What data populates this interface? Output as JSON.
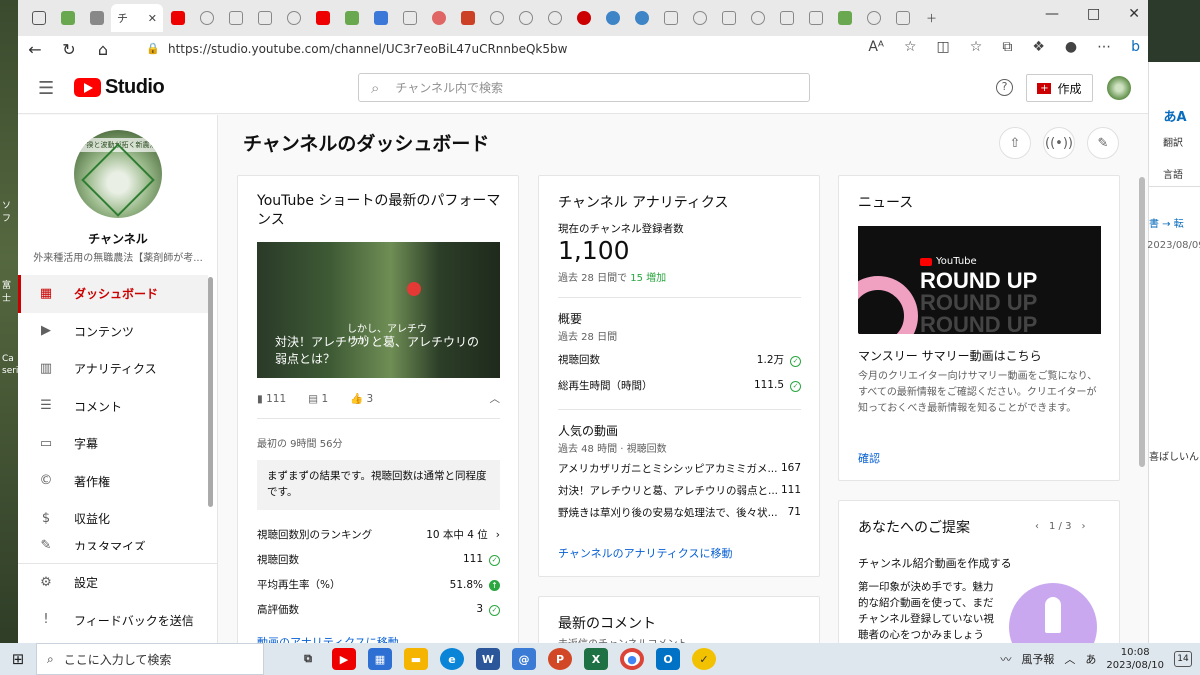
{
  "browser": {
    "url": "https://studio.youtube.com/channel/UC3r7eoBiL47uCRnnbeQk5bw",
    "active_tab_label": "チ",
    "reader_icon_text": "Aᴬ"
  },
  "studio": {
    "logo_text": "Studio",
    "search_placeholder": "チャンネル内で検索",
    "create_label": "作成",
    "help_symbol": "?"
  },
  "sidebar": {
    "channel_name": "チャンネル",
    "channel_subtitle": "外来種活用の無職農法【薬剤師が考...",
    "avatar_band_text": "一揆と波動が拓く新農法",
    "items": [
      {
        "label": "ダッシュボード",
        "icon": "dashboard-icon",
        "glyph": "▦",
        "active": true
      },
      {
        "label": "コンテンツ",
        "icon": "content-icon",
        "glyph": "▶"
      },
      {
        "label": "アナリティクス",
        "icon": "analytics-icon",
        "glyph": "▥"
      },
      {
        "label": "コメント",
        "icon": "comments-icon",
        "glyph": "☰"
      },
      {
        "label": "字幕",
        "icon": "subtitles-icon",
        "glyph": "▭"
      },
      {
        "label": "著作権",
        "icon": "copyright-icon",
        "glyph": "©"
      },
      {
        "label": "収益化",
        "icon": "earn-icon",
        "glyph": "$"
      },
      {
        "label": "カスタマイズ",
        "icon": "customize-icon",
        "glyph": "✎"
      }
    ],
    "bottom_items": [
      {
        "label": "設定",
        "icon": "settings-icon",
        "glyph": "⚙"
      },
      {
        "label": "フィードバックを送信",
        "icon": "feedback-icon",
        "glyph": "!"
      }
    ]
  },
  "dashboard": {
    "title": "チャンネルのダッシュボード",
    "shorts": {
      "title": "YouTube ショートの最新のパフォーマンス",
      "video_title": "対決！アレチウリと葛、アレチウリの弱点とは？",
      "overlay_text": "しかし、アレチウリが",
      "views": "111",
      "comments": "1",
      "likes": "3",
      "first_period": "最初の 9時間 56分",
      "message": "まずまずの結果です。視聴回数は通常と同程度です。",
      "stats": [
        {
          "label": "視聴回数別のランキング",
          "value": "10 本中 4 位",
          "indicator": "chevron"
        },
        {
          "label": "視聴回数",
          "value": "111",
          "indicator": "check"
        },
        {
          "label": "平均再生率（%）",
          "value": "51.8%",
          "indicator": "up"
        },
        {
          "label": "高評価数",
          "value": "3",
          "indicator": "check"
        }
      ],
      "link": "動画のアナリティクスに移動"
    },
    "analytics": {
      "title": "チャンネル アナリティクス",
      "subs_label": "現在のチャンネル登録者数",
      "subs_value": "1,100",
      "subs_change_prefix": "過去 28 日間で",
      "subs_change": "15 増加",
      "summary_title": "概要",
      "summary_period": "過去 28 日間",
      "summary_rows": [
        {
          "label": "視聴回数",
          "value": "1.2万"
        },
        {
          "label": "総再生時間（時間）",
          "value": "111.5"
        }
      ],
      "top_title": "人気の動画",
      "top_period": "過去 48 時間 · 視聴回数",
      "top_videos": [
        {
          "title": "アメリカザリガニとミシシッピアカミミガメ...",
          "views": "167"
        },
        {
          "title": "対決！アレチウリと葛、アレチウリの弱点と...",
          "views": "111"
        },
        {
          "title": "野焼きは草刈り後の安易な処理法で、後々状...",
          "views": "71"
        }
      ],
      "link": "チャンネルのアナリティクスに移動"
    },
    "comments": {
      "title": "最新のコメント",
      "subtitle": "未返信のチャンネルコメント"
    },
    "news": {
      "title": "ニュース",
      "image_brand": "YouTube",
      "image_text": "ROUND UP",
      "headline": "マンスリー サマリー動画はこちら",
      "body": "今月のクリエイター向けサマリー動画をご覧になり、すべての最新情報をご確認ください。クリエイターが知っておくべき最新情報を知ることができます。",
      "link": "確認"
    },
    "suggestions": {
      "title": "あなたへのご提案",
      "pager": "1 / 3",
      "headline": "チャンネル紹介動画を作成する",
      "body": "第一印象が決め手です。魅力的な紹介動画を使って、まだチャンネル登録していない視聴者の心をつかみましょう"
    }
  },
  "side_panel": {
    "translate_label": "翻訳",
    "language_label": "言語",
    "date": "2023/08/09",
    "text": "喜ばしいん"
  },
  "desktop": {
    "labels": [
      "ソフ",
      "富士",
      "Ca",
      "seri"
    ]
  },
  "taskbar": {
    "search_placeholder": "ここに入力して検索",
    "weather": "風予報",
    "ime": "あ",
    "time": "10:08",
    "date": "2023/08/10",
    "notifications": "14"
  }
}
